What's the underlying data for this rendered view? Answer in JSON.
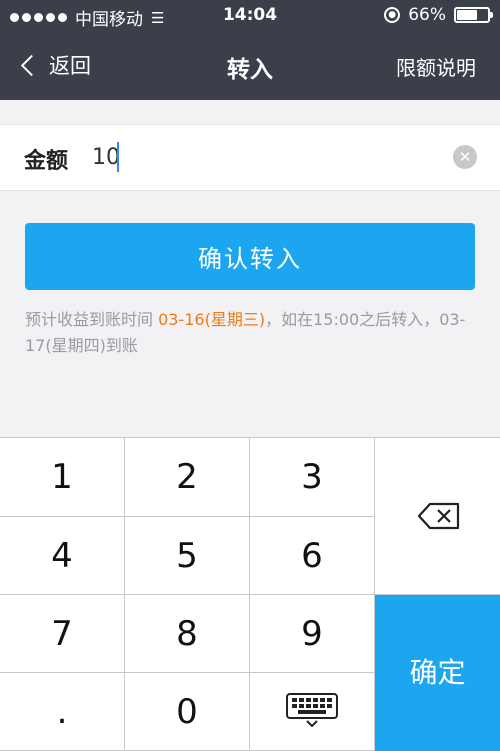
{
  "statusbar": {
    "carrier": "中国移动",
    "time": "14:04",
    "battery": "66%",
    "battery_level": 0.66
  },
  "navbar": {
    "back_label": "返回",
    "title": "转入",
    "limit_label": "限额说明"
  },
  "amount": {
    "label": "金额",
    "value": "10"
  },
  "confirm_label": "确认转入",
  "info": {
    "prefix": "预计收益到账时间 ",
    "highlight": "03-16(星期三)",
    "suffix": "，如在15:00之后转入，03-17(星期四)到账"
  },
  "keypad": {
    "keys": [
      "1",
      "2",
      "3",
      "4",
      "5",
      "6",
      "7",
      "8",
      "9",
      ".",
      "0"
    ],
    "confirm": "确定"
  },
  "colors": {
    "accent": "#1ca6ef",
    "highlight": "#f07a14",
    "navbar": "#3a3f4a"
  }
}
